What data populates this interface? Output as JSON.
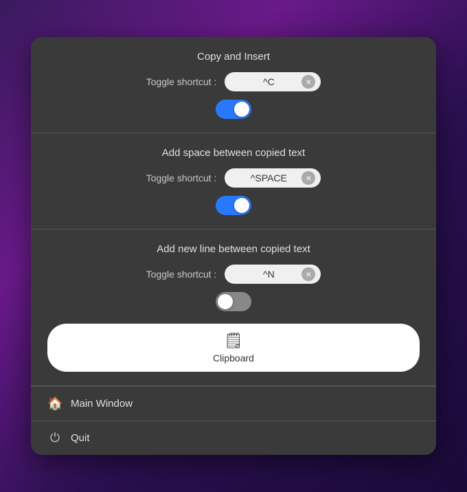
{
  "sections": [
    {
      "id": "copy-insert",
      "title": "Copy and Insert",
      "shortcut_label": "Toggle shortcut :",
      "shortcut_value": "^C",
      "toggle_on": true
    },
    {
      "id": "add-space",
      "title": "Add space between copied text",
      "shortcut_label": "Toggle shortcut :",
      "shortcut_value": "^SPACE",
      "toggle_on": true
    },
    {
      "id": "add-newline",
      "title": "Add new line between copied text",
      "shortcut_label": "Toggle shortcut :",
      "shortcut_value": "^N",
      "toggle_on": false
    }
  ],
  "clipboard_button": {
    "label": "Clipboard",
    "icon": "📋"
  },
  "menu_items": [
    {
      "id": "main-window",
      "label": "Main Window",
      "icon": "home"
    },
    {
      "id": "quit",
      "label": "Quit",
      "icon": "power"
    }
  ]
}
